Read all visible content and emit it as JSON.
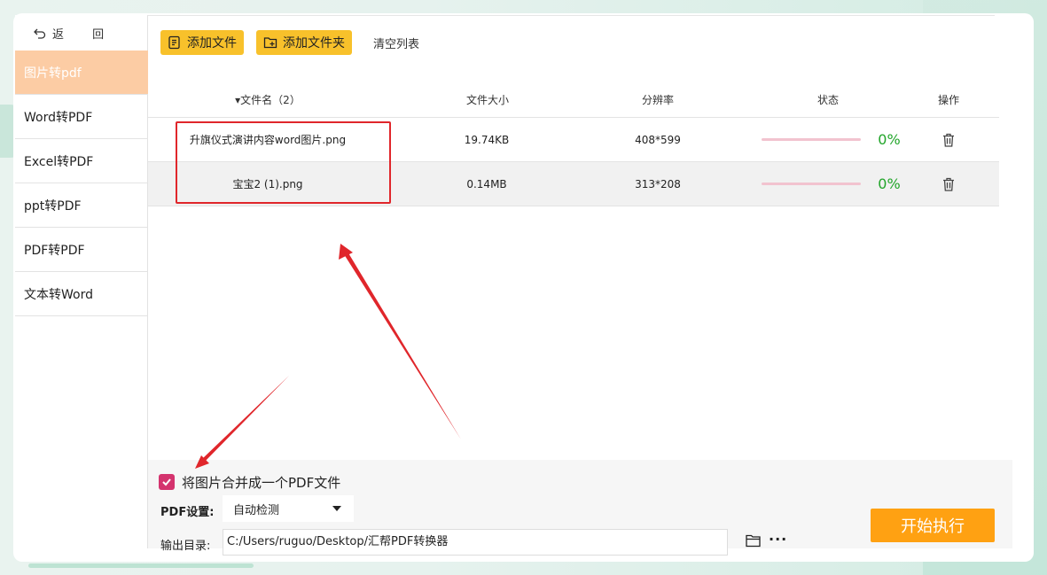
{
  "sidebar": {
    "back_label": "返 回",
    "items": [
      {
        "label": "图片转pdf",
        "active": true
      },
      {
        "label": "Word转PDF"
      },
      {
        "label": "Excel转PDF"
      },
      {
        "label": "ppt转PDF"
      },
      {
        "label": "PDF转PDF"
      },
      {
        "label": "文本转Word"
      }
    ]
  },
  "toolbar": {
    "add_file": "添加文件",
    "add_folder": "添加文件夹",
    "clear": "清空列表"
  },
  "table": {
    "headers": {
      "name": "▾文件名（2）",
      "size": "文件大小",
      "resolution": "分辨率",
      "status": "状态",
      "action": "操作"
    },
    "rows": [
      {
        "name": "升旗仪式演讲内容word图片.png",
        "size": "19.74KB",
        "resolution": "408*599",
        "progress": "0%"
      },
      {
        "name": "宝宝2 (1).png",
        "size": "0.14MB",
        "resolution": "313*208",
        "progress": "0%"
      }
    ]
  },
  "settings": {
    "merge_label": "将图片合并成一个PDF文件",
    "merge_checked": true,
    "pdf_label": "PDF设置:",
    "pdf_value": "自动检测",
    "output_label": "输出目录:",
    "output_value": "C:/Users/ruguo/Desktop/汇帮PDF转换器",
    "more": "···",
    "start": "开始执行"
  },
  "colors": {
    "accent_button": "#f8c12b",
    "start_button": "#ffa112",
    "active_menu": "#fccca4",
    "progress_text": "#22a52a",
    "annotation": "#e0262b"
  }
}
